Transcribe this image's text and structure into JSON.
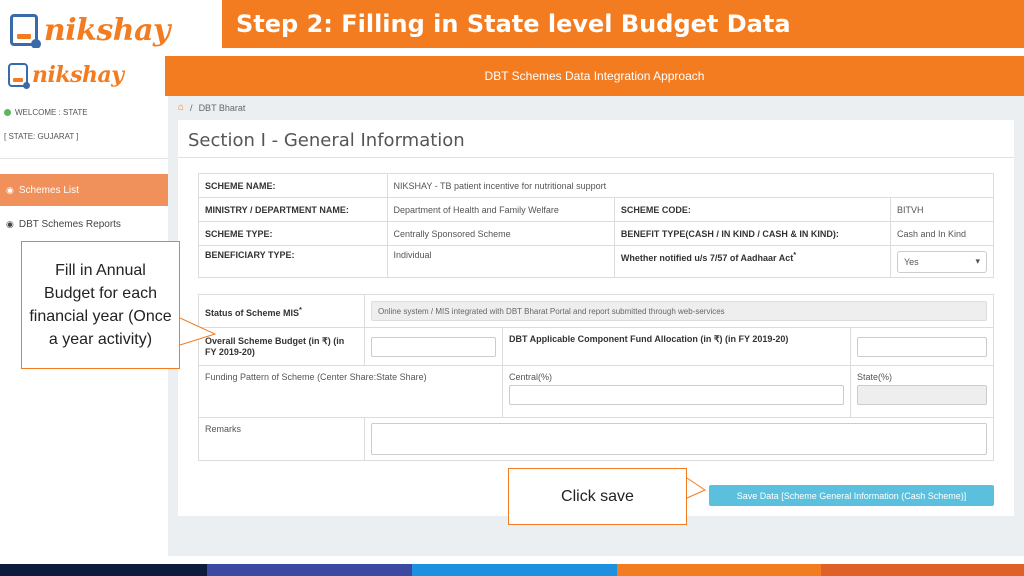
{
  "slide": {
    "logo_text": "nikshay",
    "title": "Step 2: Filling in State level Budget Data"
  },
  "app": {
    "header": "DBT Schemes Data Integration Approach",
    "logo_text": "nikshay",
    "welcome": "WELCOME : STATE",
    "state": "[ STATE: GUJARAT ]",
    "nav": [
      {
        "label": "Schemes List",
        "icon": "dashboard-icon",
        "active": true
      },
      {
        "label": "DBT Schemes Reports",
        "icon": "dashboard-icon",
        "active": false
      }
    ],
    "breadcrumb": {
      "home_icon": "home-icon",
      "separator": "/",
      "current": "DBT Bharat"
    },
    "section_title": "Section I - General Information",
    "scheme_info": {
      "scheme_name_label": "SCHEME NAME:",
      "scheme_name": "NIKSHAY - TB patient incentive for nutritional support",
      "ministry_label": "MINISTRY / DEPARTMENT NAME:",
      "ministry": "Department of Health and Family Welfare",
      "scheme_code_label": "SCHEME CODE:",
      "scheme_code": "BITVH",
      "scheme_type_label": "SCHEME TYPE:",
      "scheme_type": "Centrally Sponsored Scheme",
      "benefit_type_label": "BENEFIT TYPE(CASH / IN KIND / CASH & IN KIND):",
      "benefit_type": "Cash and In Kind",
      "beneficiary_type_label": "BENEFICIARY TYPE:",
      "beneficiary_type": "Individual",
      "aadhaar_label": "Whether notified u/s 7/57 of Aadhaar Act",
      "aadhaar_value": "Yes",
      "required_mark": "*"
    },
    "budget": {
      "mis_label": "Status of Scheme MIS",
      "mis_value": "Online system / MIS integrated with DBT Bharat Portal and report submitted through web-services",
      "overall_budget_label": "Overall Scheme Budget (in ₹) (in FY 2019-20)",
      "overall_budget_value": "",
      "dbt_component_label": "DBT Applicable Component Fund Allocation (in ₹) (in FY 2019-20)",
      "dbt_component_value": "",
      "funding_pattern_label": "Funding Pattern of Scheme (Center Share:State Share)",
      "central_label": "Central(%)",
      "central_value": "",
      "state_label": "State(%)",
      "state_value": "",
      "remarks_label": "Remarks",
      "remarks_value": ""
    },
    "save_button": "Save Data [Scheme General Information (Cash Scheme)]"
  },
  "callouts": {
    "left": "Fill in Annual Budget for each financial year (Once a year activity)",
    "right": "Click save"
  },
  "colors": {
    "brand_orange": "#f47c20",
    "save_button": "#5bc0de",
    "stripe": [
      "#0d1b3e",
      "#3b4aa0",
      "#1e90e0",
      "#f47c20",
      "#e0602a"
    ]
  }
}
